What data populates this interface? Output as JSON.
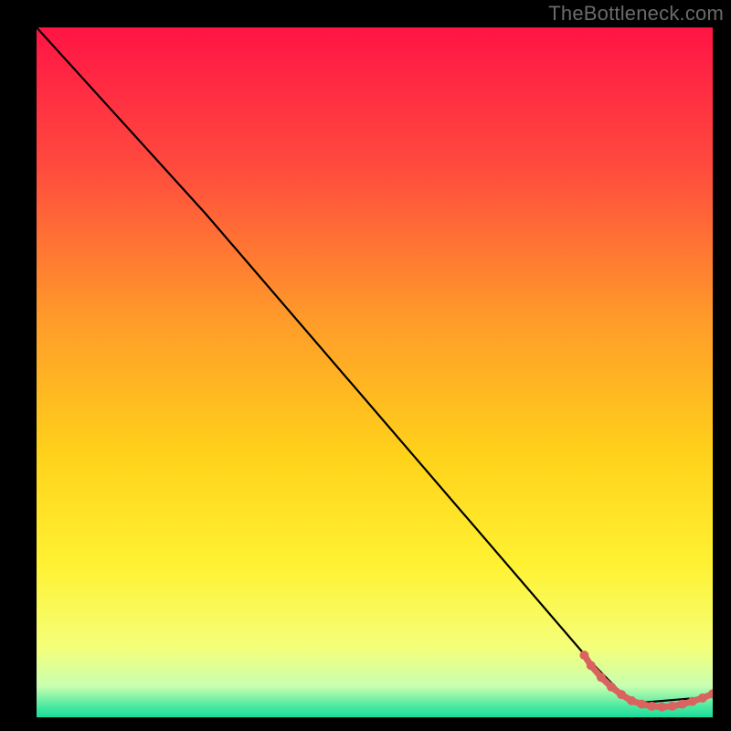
{
  "attribution": "TheBottleneck.com",
  "chart_data": {
    "type": "line",
    "title": "",
    "xlabel": "",
    "ylabel": "",
    "xlim": [
      0,
      100
    ],
    "ylim": [
      0,
      100
    ],
    "series": [
      {
        "name": "curve",
        "x": [
          0,
          25,
          82,
          88,
          100
        ],
        "y": [
          100,
          73,
          8,
          2,
          3
        ],
        "stroke": "#000000",
        "stroke_width": 2.2,
        "fill": "none"
      },
      {
        "name": "highlight-segment",
        "x": [
          81,
          82,
          83.5,
          85,
          86.5,
          88,
          89.5,
          91,
          92.5,
          94,
          95.5,
          97,
          98.5,
          100
        ],
        "y": [
          9.0,
          7.5,
          5.8,
          4.4,
          3.3,
          2.4,
          1.9,
          1.6,
          1.5,
          1.6,
          1.9,
          2.3,
          2.8,
          3.4
        ],
        "stroke": "#d9645f",
        "stroke_width": 7,
        "fill": "none",
        "marker_color": "#d9645f",
        "marker_radius": 5
      }
    ],
    "background_gradient_stops": [
      {
        "offset": 0.0,
        "color": "#ff1445"
      },
      {
        "offset": 0.2,
        "color": "#ff4a3e"
      },
      {
        "offset": 0.42,
        "color": "#ff9a2a"
      },
      {
        "offset": 0.62,
        "color": "#ffd21a"
      },
      {
        "offset": 0.78,
        "color": "#fff233"
      },
      {
        "offset": 0.9,
        "color": "#f4ff7a"
      },
      {
        "offset": 0.955,
        "color": "#c7ffb0"
      },
      {
        "offset": 0.985,
        "color": "#49e8a0"
      },
      {
        "offset": 1.0,
        "color": "#18dd9c"
      }
    ]
  }
}
